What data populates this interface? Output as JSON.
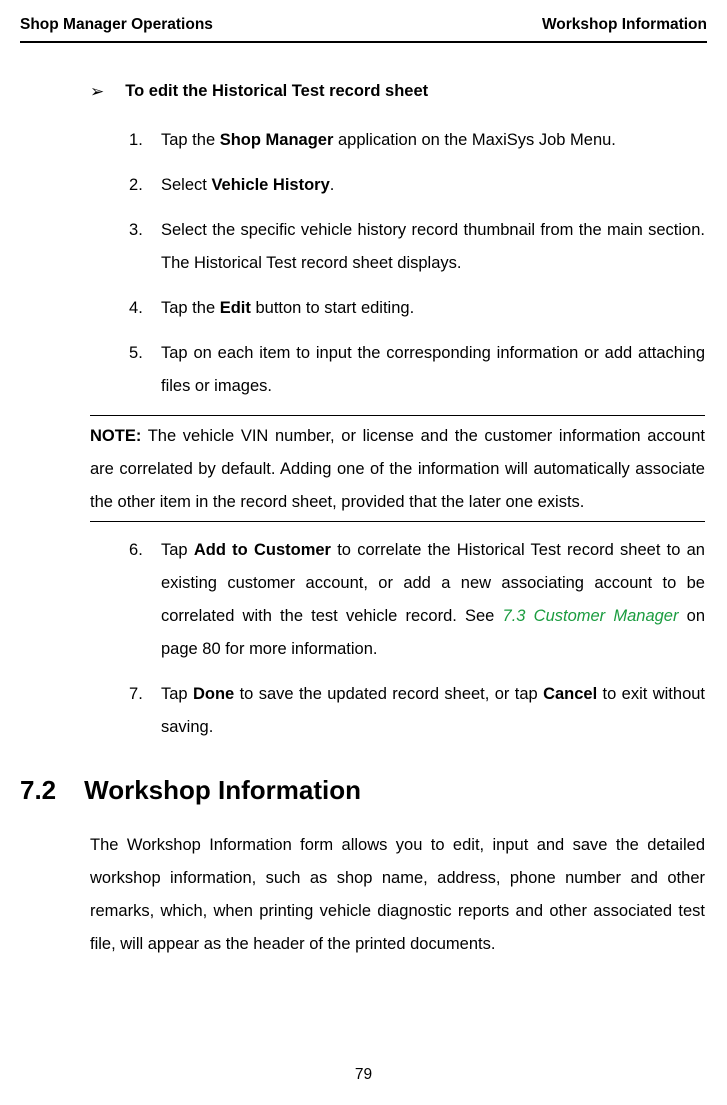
{
  "header": {
    "left": "Shop Manager Operations",
    "right": "Workshop Information"
  },
  "procedure": {
    "title": "To edit the Historical Test record sheet",
    "steps": {
      "s1_a": "Tap the ",
      "s1_b": "Shop Manager",
      "s1_c": " application on the MaxiSys Job Menu.",
      "s2_a": "Select ",
      "s2_b": "Vehicle History",
      "s2_c": ".",
      "s3": "Select the specific vehicle history record thumbnail from the main section. The Historical Test record sheet displays.",
      "s4_a": "Tap the ",
      "s4_b": "Edit",
      "s4_c": " button to start editing.",
      "s5": "Tap on each item to input the corresponding information or add attaching files or images.",
      "s6_a": "Tap ",
      "s6_b": "Add to Customer",
      "s6_c": " to correlate the Historical Test record sheet to an existing customer account, or add a new associating account to be correlated with the test vehicle record. See ",
      "s6_d": "7.3 Customer Manager",
      "s6_e": " on page 80 for more information.",
      "s7_a": "Tap ",
      "s7_b": "Done",
      "s7_c": " to save the updated record sheet, or tap ",
      "s7_d": "Cancel",
      "s7_e": " to exit without saving."
    }
  },
  "note": {
    "label": "NOTE:",
    "text": " The vehicle VIN number, or license and the customer information account are correlated by default. Adding one of the information will automatically associate the other item in the record sheet, provided that the later one exists."
  },
  "section": {
    "number": "7.2",
    "title": "Workshop Information",
    "body": "The Workshop Information form allows you to edit, input and save the detailed workshop information, such as shop name, address, phone number and other remarks, which, when printing vehicle diagnostic reports and other associated test file, will appear as the header of the printed documents."
  },
  "page_number": "79"
}
